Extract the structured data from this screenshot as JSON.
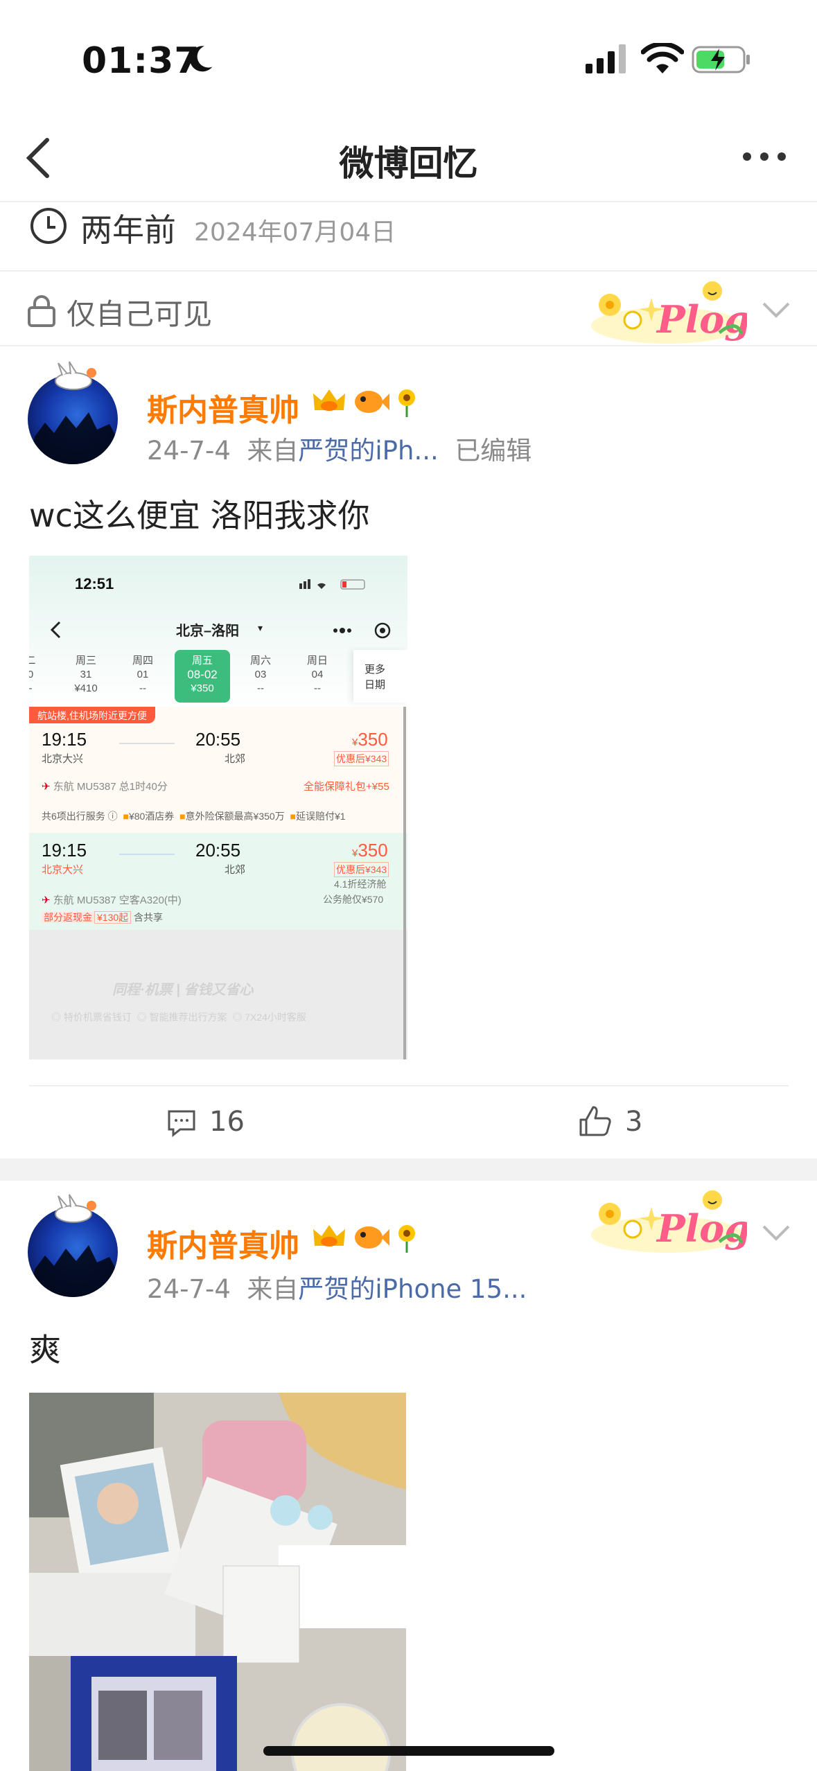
{
  "status_bar": {
    "time": "01:37"
  },
  "nav": {
    "title": "微博回忆"
  },
  "memory": {
    "ago": "两年前",
    "date": "2024年07月04日",
    "visibility": "仅自己可见"
  },
  "posts": [
    {
      "username": "斯内普真帅",
      "date": "24-7-4",
      "from_prefix": "来自",
      "source": "严贺的iPh...",
      "edited": "已编辑",
      "text": "wc这么便宜 洛阳我求你",
      "comments": "16",
      "likes": "3"
    },
    {
      "username": "斯内普真帅",
      "date": "24-7-4",
      "from_prefix": "来自",
      "source": "严贺的iPhone 15...",
      "text": "爽"
    }
  ],
  "embedded": {
    "time": "12:51",
    "route": "北京–洛阳",
    "days": [
      {
        "w": "二",
        "d": "0",
        "p": "-"
      },
      {
        "w": "周三",
        "d": "31",
        "p": "¥410"
      },
      {
        "w": "周四",
        "d": "01",
        "p": "--"
      },
      {
        "w": "周五",
        "d": "08-02",
        "p": "¥350"
      },
      {
        "w": "周六",
        "d": "03",
        "p": "--"
      },
      {
        "w": "周日",
        "d": "04",
        "p": "--"
      }
    ],
    "more_dates_1": "更多",
    "more_dates_2": "日期",
    "tip": "航站楼,住机场附近更方便",
    "f1_dep": "19:15",
    "f1_dep_ap": "北京大兴",
    "f1_arr": "20:55",
    "f1_arr_ap": "北郊",
    "f1_price": "350",
    "f1_disc": "优惠后¥343",
    "f1_flight": "东航 MU5387  总1时40分",
    "f1_gift": "全能保障礼包+¥55",
    "f1_services": "共6项出行服务 ⓘ",
    "f1_hotel": "¥80酒店券",
    "f1_insure": "意外险保额最高¥350万",
    "f1_delay": "延误赔付¥1",
    "f2_dep": "19:15",
    "f2_dep_ap": "北京大兴",
    "f2_arr": "20:55",
    "f2_arr_ap": "北郊",
    "f2_price": "350",
    "f2_disc": "优惠后¥343",
    "f2_flight": "东航 MU5387  空客A320(中)",
    "f2_class": "4.1折经济舱",
    "f2_biz": "公务舱仅¥570",
    "f2_cash": "部分返现金",
    "f2_cash_amt": "¥130起",
    "f2_share": "含共享",
    "brand": "同程·机票 | 省钱又省心",
    "feat1": "特价机票省钱订",
    "feat2": "智能推荐出行方案",
    "feat3": "7X24小时客服"
  },
  "colors": {
    "username": "#ff7a00",
    "source_link": "#4b6aa8",
    "selected_day": "#3dbd7d",
    "price": "#ff5a3c"
  }
}
